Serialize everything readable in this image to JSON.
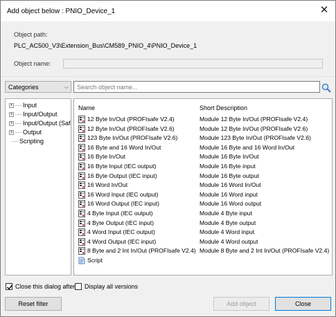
{
  "window": {
    "title": "Add object below : PNIO_Device_1"
  },
  "header": {
    "object_path_label": "Object path:",
    "object_path": "PLC_AC500_V3\\Extension_Bus\\CM589_PNIO_4\\PNIO_Device_1",
    "object_name_label": "Object name:",
    "object_name": ""
  },
  "filter": {
    "category_selected": "Categories",
    "search_placeholder": "Search object name..."
  },
  "tree": {
    "items": [
      {
        "label": "Input",
        "expandable": true
      },
      {
        "label": "Input/Output",
        "expandable": true
      },
      {
        "label": "Input/Output (Safet",
        "expandable": true
      },
      {
        "label": "Output",
        "expandable": true
      },
      {
        "label": "Scripting",
        "expandable": false
      }
    ]
  },
  "grid": {
    "columns": [
      "Name",
      "Short Description"
    ],
    "rows": [
      {
        "name": "12 Byte In/Out (PROFIsafe V2.4)",
        "desc": "Module 12 Byte In/Out (PROFIsafe V2.4)",
        "icon": "module-icon"
      },
      {
        "name": "12 Byte In/Out (PROFIsafe V2.6)",
        "desc": "Module 12 Byte In/Out (PROFIsafe V2.6)",
        "icon": "module-icon"
      },
      {
        "name": "123 Byte In/Out (PROFIsafe V2.6)",
        "desc": "Module 123 Byte In/Out (PROFIsafe V2.6)",
        "icon": "module-icon"
      },
      {
        "name": "16 Byte and 16 Word In/Out",
        "desc": "Module 16 Byte and 16 Word In/Out",
        "icon": "module-icon"
      },
      {
        "name": "16 Byte In/Out",
        "desc": "Module 16 Byte In/Out",
        "icon": "module-icon"
      },
      {
        "name": "16 Byte Input (IEC output)",
        "desc": "Module 16 Byte input",
        "icon": "module-icon"
      },
      {
        "name": "16 Byte Output (IEC input)",
        "desc": "Module 16 Byte output",
        "icon": "module-icon"
      },
      {
        "name": "16 Word In/Out",
        "desc": "Module 16 Word In/Out",
        "icon": "module-icon"
      },
      {
        "name": "16 Word Input (IEC output)",
        "desc": "Module 16 Word input",
        "icon": "module-icon"
      },
      {
        "name": "16 Word Output (IEC input)",
        "desc": "Module 16 Word output",
        "icon": "module-icon"
      },
      {
        "name": "4 Byte Input (IEC output)",
        "desc": "Module 4 Byte input",
        "icon": "module-icon"
      },
      {
        "name": "4 Byte Output (IEC input)",
        "desc": "Module 4 Byte output",
        "icon": "module-icon"
      },
      {
        "name": "4 Word Input (IEC output)",
        "desc": "Module 4 Word input",
        "icon": "module-icon"
      },
      {
        "name": "4 Word Output (IEC input)",
        "desc": "Module 4 Word output",
        "icon": "module-icon"
      },
      {
        "name": "8 Byte and 2 Int In/Out (PROFIsafe V2.4)",
        "desc": "Module 8 Byte and 2 Int In/Out (PROFIsafe V2.4)",
        "icon": "module-icon"
      },
      {
        "name": "Script",
        "desc": "",
        "icon": "script-icon"
      }
    ]
  },
  "options": {
    "close_dialog_label": "Close this dialog after",
    "close_dialog_checked": true,
    "display_all_label": "Display all versions",
    "display_all_checked": false
  },
  "buttons": {
    "reset_filter": "Reset filter",
    "add_object": "Add object",
    "close": "Close"
  },
  "colors": {
    "accent": "#0078d7",
    "panel": "#f0f0f0"
  }
}
